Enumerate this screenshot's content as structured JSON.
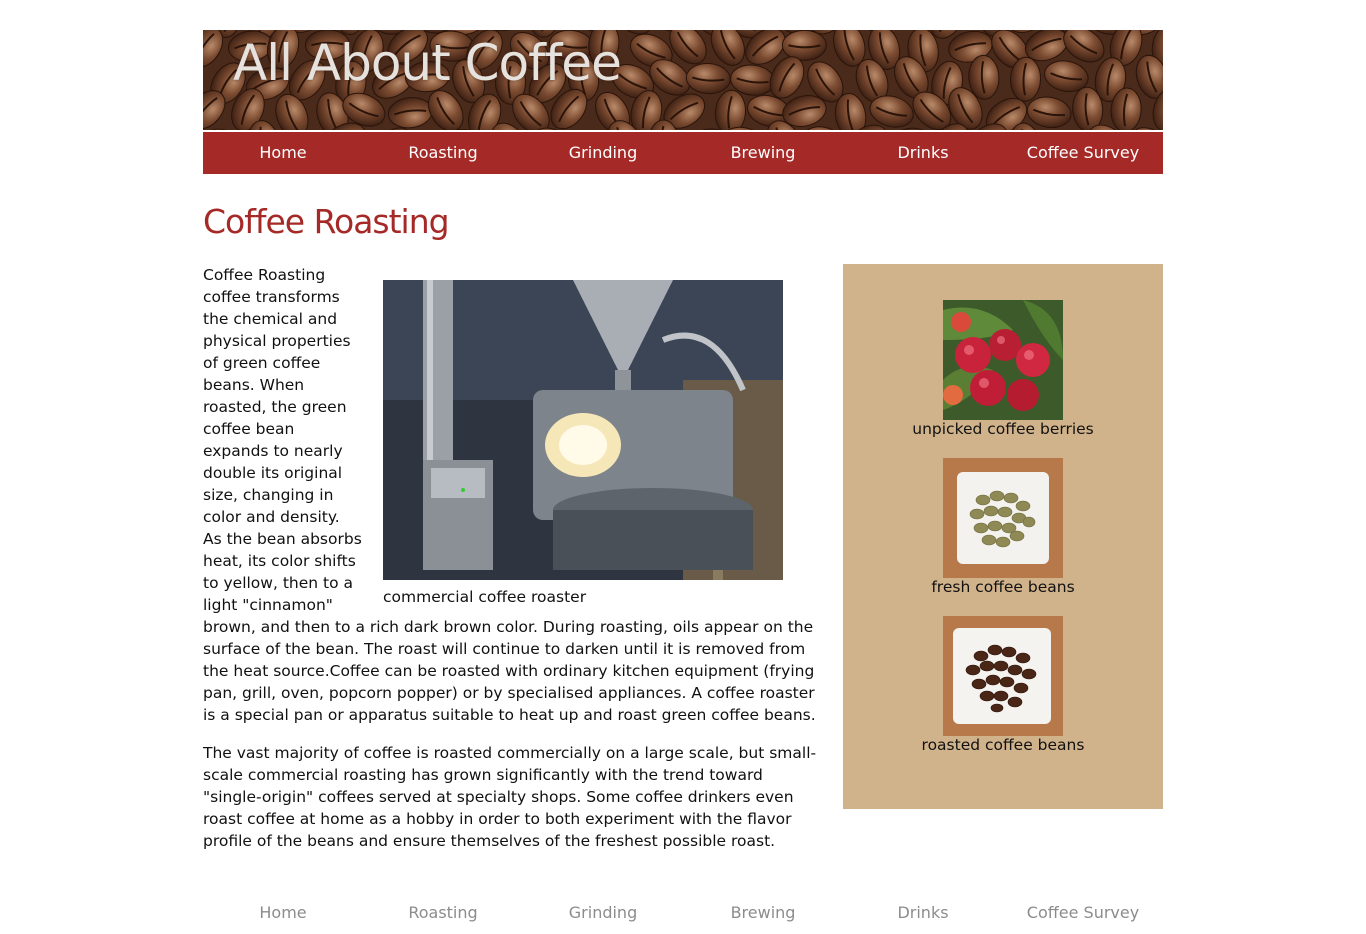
{
  "site": {
    "title": "All About Coffee"
  },
  "nav": [
    {
      "label": "Home"
    },
    {
      "label": "Roasting"
    },
    {
      "label": "Grinding"
    },
    {
      "label": "Brewing"
    },
    {
      "label": "Drinks"
    },
    {
      "label": "Coffee Survey"
    }
  ],
  "page": {
    "heading": "Coffee Roasting",
    "paragraphs": [
      "Coffee Roasting coffee transforms the chemical and physical properties of green coffee beans. When roasted, the green coffee bean expands to nearly double its original size, changing in color and density. As the bean absorbs heat, its color shifts to yellow, then to a light \"cinnamon\" brown, and then to a rich dark brown color. During roasting, oils appear on the surface of the bean. The roast will continue to darken until it is removed from the heat source.Coffee can be roasted with ordinary kitchen equipment (frying pan, grill, oven, popcorn popper) or by specialised appliances. A coffee roaster is a special pan or apparatus suitable to heat up and roast green coffee beans.",
      "The vast majority of coffee is roasted commercially on a large scale, but small-scale commercial roasting has grown significantly with the trend toward \"single-origin\" coffees served at specialty shops. Some coffee drinkers even roast coffee at home as a hobby in order to both experiment with the flavor profile of the beans and ensure themselves of the freshest possible roast."
    ],
    "figure_caption": "commercial coffee roaster"
  },
  "sidebar": {
    "items": [
      {
        "caption": "unpicked coffee berries",
        "icon": "coffee-berries-photo"
      },
      {
        "caption": "fresh coffee beans",
        "icon": "green-beans-photo"
      },
      {
        "caption": "roasted coffee beans",
        "icon": "roasted-beans-photo"
      }
    ]
  },
  "footer_nav": [
    {
      "label": "Home"
    },
    {
      "label": "Roasting"
    },
    {
      "label": "Grinding"
    },
    {
      "label": "Brewing"
    },
    {
      "label": "Drinks"
    },
    {
      "label": "Coffee Survey"
    }
  ],
  "colors": {
    "accent": "#a52a27",
    "sidebar_bg": "#d1b38b",
    "footer_link": "#8c8c8c"
  }
}
